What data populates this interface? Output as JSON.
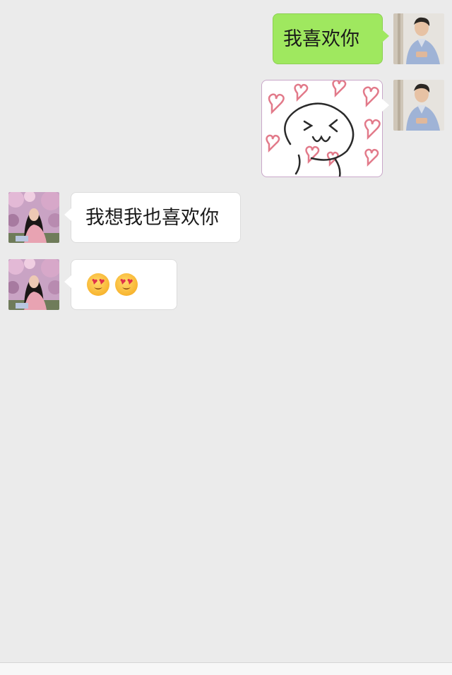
{
  "messages": [
    {
      "id": 1,
      "side": "right",
      "type": "text",
      "text": "我喜欢你"
    },
    {
      "id": 2,
      "side": "right",
      "type": "sticker",
      "sticker_icon": "heart-face-sticker"
    },
    {
      "id": 3,
      "side": "left",
      "type": "text",
      "text": "我想我也喜欢你"
    },
    {
      "id": 4,
      "side": "left",
      "type": "emoji",
      "emojis": [
        "heart-eyes-emoji",
        "heart-eyes-emoji"
      ]
    }
  ],
  "colors": {
    "background": "#ebebeb",
    "sent_bubble": "#9fe85f",
    "received_bubble": "#ffffff",
    "heart": "#e27a8a"
  }
}
